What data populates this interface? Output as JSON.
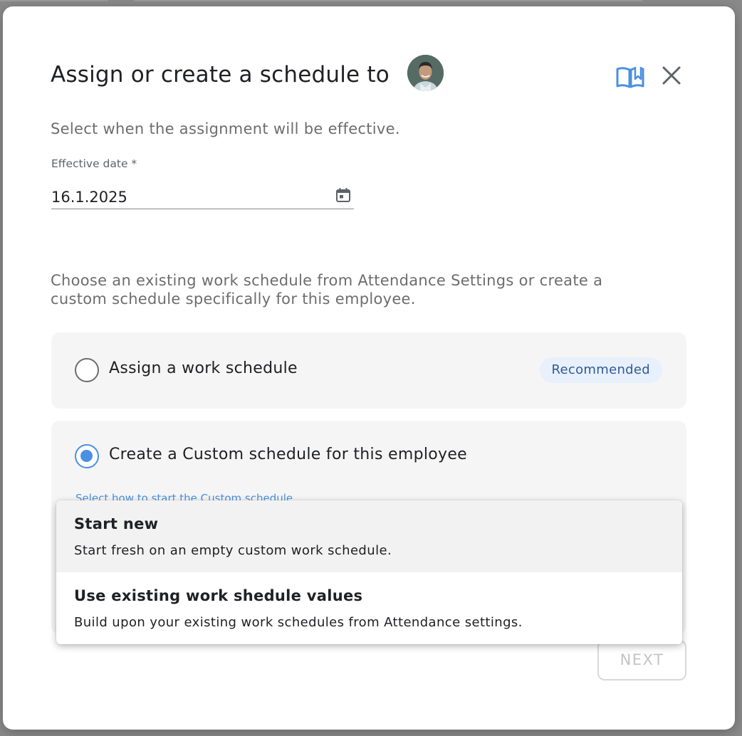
{
  "dialog": {
    "title": "Assign or create a schedule to",
    "subtitle": "Select when the assignment will be effective.",
    "effective_date": {
      "label": "Effective date *",
      "value": "16.1.2025"
    },
    "description": "Choose an existing work schedule from Attendance Settings or create a custom schedule specifically for this employee.",
    "options": [
      {
        "label": "Assign a work schedule",
        "badge": "Recommended",
        "selected": false
      },
      {
        "label": "Create a Custom schedule for this employee",
        "selected": true,
        "hint": "Select how to start the Custom schedule"
      }
    ],
    "menu": [
      {
        "title": "Start new",
        "description": "Start fresh on an empty custom work schedule.",
        "highlighted": true
      },
      {
        "title": "Use existing work shedule values",
        "description": "Build upon your existing work schedules from Attendance settings.",
        "highlighted": false
      }
    ],
    "next_label": "NEXT"
  },
  "colors": {
    "accent": "#4a90e2",
    "badge_bg": "#e8f0fb",
    "badge_text": "#2e5c99",
    "card_bg": "#f5f5f5"
  },
  "icons": {
    "help": "open-book-icon",
    "close": "close-icon",
    "calendar": "calendar-icon"
  }
}
